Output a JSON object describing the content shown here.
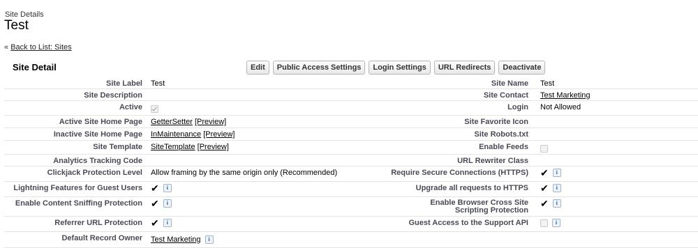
{
  "header": {
    "page_type": "Site Details",
    "title": "Test"
  },
  "back": {
    "prefix": "«",
    "label": "Back to List: Sites"
  },
  "section": {
    "title": "Site Detail"
  },
  "buttons": [
    "Edit",
    "Public Access Settings",
    "Login Settings",
    "URL Redirects",
    "Deactivate"
  ],
  "left": {
    "site_label": {
      "label": "Site Label",
      "value": "Test"
    },
    "site_description": {
      "label": "Site Description",
      "value": ""
    },
    "active": {
      "label": "Active",
      "checked": true
    },
    "active_home": {
      "label": "Active Site Home Page",
      "link": "GetterSetter",
      "preview": "[Preview]"
    },
    "inactive_home": {
      "label": "Inactive Site Home Page",
      "link": "InMaintenance",
      "preview": "[Preview]"
    },
    "site_template": {
      "label": "Site Template",
      "link": "SiteTemplate",
      "preview": "[Preview]"
    },
    "analytics": {
      "label": "Analytics Tracking Code",
      "value": ""
    },
    "clickjack": {
      "label": "Clickjack Protection Level",
      "value": "Allow framing by the same origin only (Recommended)"
    },
    "lightning_guest": {
      "label": "Lightning Features for Guest Users",
      "checked": true
    },
    "content_sniffing": {
      "label": "Enable Content Sniffing Protection",
      "checked": true
    },
    "referrer": {
      "label": "Referrer URL Protection",
      "checked": true
    },
    "record_owner": {
      "label": "Default Record Owner",
      "link": "Test Marketing"
    }
  },
  "right": {
    "site_name": {
      "label": "Site Name",
      "value": "Test"
    },
    "site_contact": {
      "label": "Site Contact",
      "link": "Test Marketing"
    },
    "login": {
      "label": "Login",
      "value": "Not Allowed"
    },
    "favicon": {
      "label": "Site Favorite Icon",
      "value": ""
    },
    "robots": {
      "label": "Site Robots.txt",
      "value": ""
    },
    "enable_feeds": {
      "label": "Enable Feeds",
      "checked": false
    },
    "url_rewriter": {
      "label": "URL Rewriter Class",
      "value": ""
    },
    "secure_conn": {
      "label": "Require Secure Connections (HTTPS)",
      "checked": true
    },
    "upgrade_https": {
      "label": "Upgrade all requests to HTTPS",
      "checked": true
    },
    "xss": {
      "label": "Enable Browser Cross Site Scripting Protection",
      "checked": true
    },
    "guest_support": {
      "label": "Guest Access to the Support API",
      "checked": false
    }
  },
  "icons": {
    "info": "info-icon",
    "check": "checkmark-icon"
  },
  "colors": {
    "label": "#4a4a56",
    "info": "#1f5fa0",
    "divider": "#e3e3e3"
  }
}
